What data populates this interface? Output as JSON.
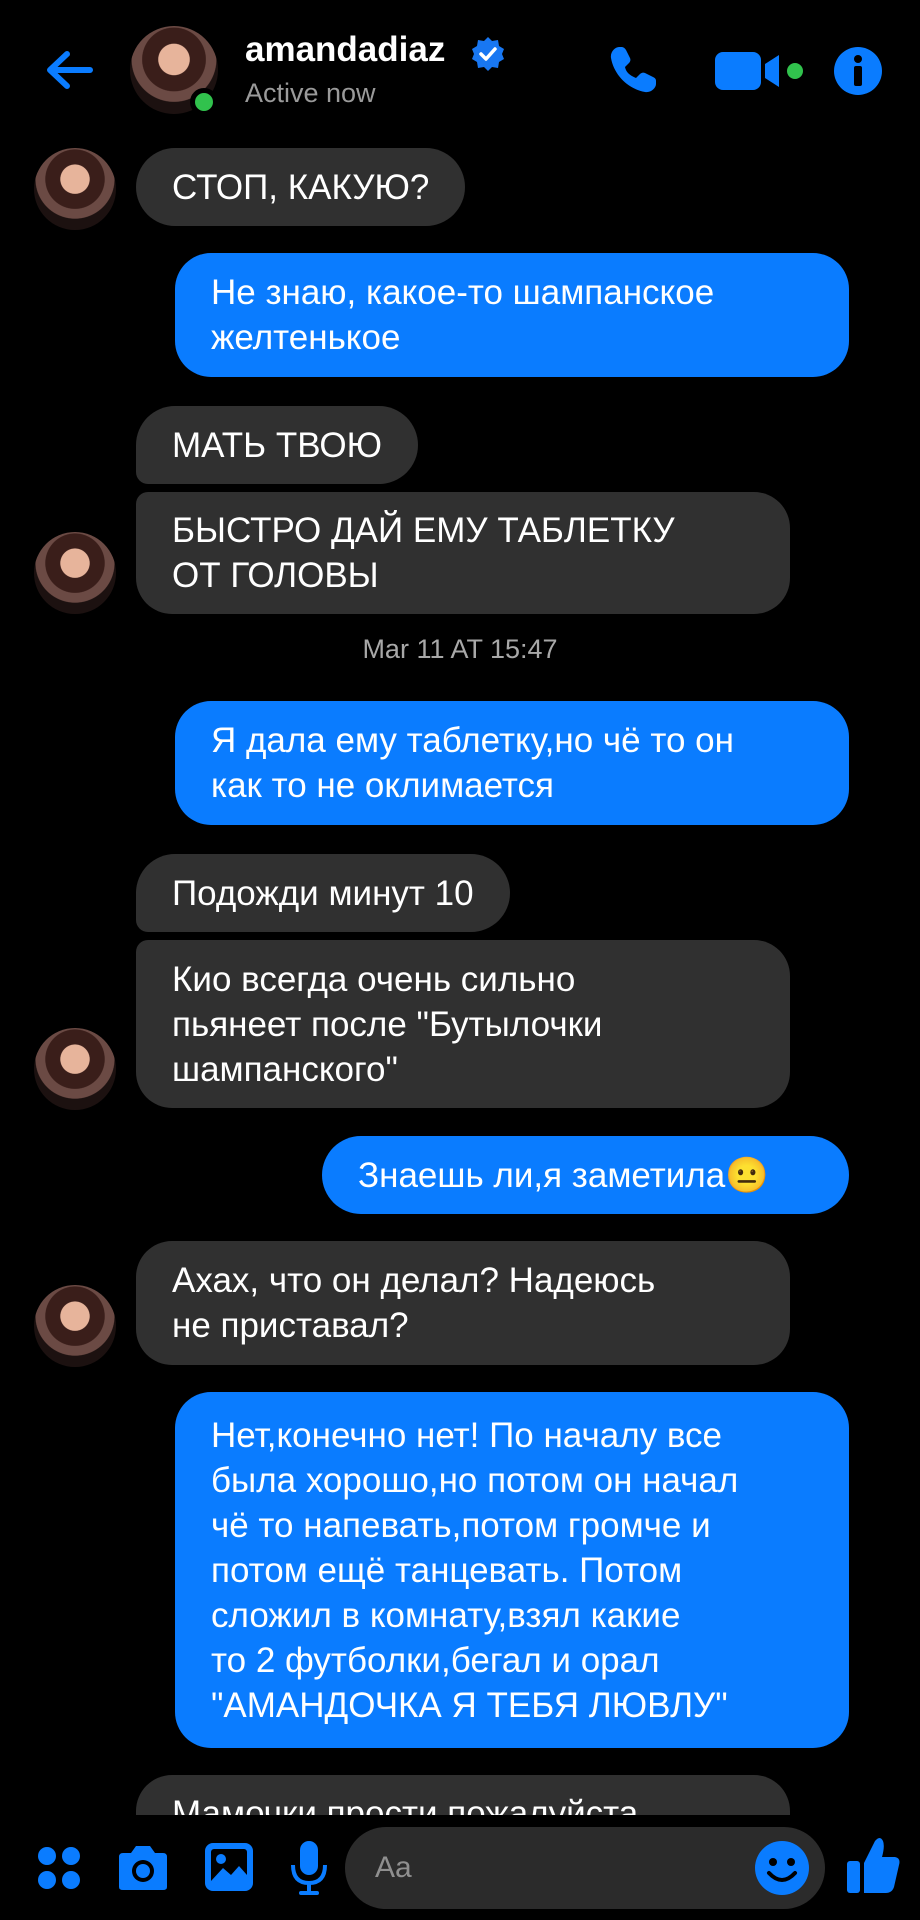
{
  "header": {
    "name": "amandadiaz",
    "status": "Active now"
  },
  "messages": [
    {
      "side": "in",
      "text": "СТОП, КАКУЮ?"
    },
    {
      "side": "out",
      "text": "Не знаю, какое-то шампанское\nжелтенькое"
    },
    {
      "side": "in",
      "text": "МАТЬ ТВОЮ"
    },
    {
      "side": "in",
      "text": "БЫСТРО ДАЙ ЕМУ ТАБЛЕТКУ\nОТ ГОЛОВЫ"
    },
    {
      "side": "timestamp",
      "text": "Mar 11 AT 15:47"
    },
    {
      "side": "out",
      "text": "Я дала ему таблетку,но чё то он\nкак то не оклимается"
    },
    {
      "side": "in",
      "text": "Подожди минут 10"
    },
    {
      "side": "in",
      "text": "Кио всегда очень сильно\nпьянеет после \"Бутылочки\nшампанского\""
    },
    {
      "side": "out",
      "text": "Знаешь ли,я заметила😐"
    },
    {
      "side": "in",
      "text": "Ахах, что он делал? Надеюсь\nне приставал?"
    },
    {
      "side": "out",
      "text": "Нет,конечно нет! По началу все\nбыла хорошо,но потом он начал\nчё то напевать,потом громче и\nпотом ещё танцевать. Потом\nсложил в комнату,взял какие\nто 2 футболки,бегал и орал\n\"АМАНДОЧКА Я ТЕБЯ ЛЮВЛУ\""
    },
    {
      "side": "in",
      "text": "Мамочки прости пожалуйста"
    }
  ],
  "composer": {
    "placeholder": "Aa"
  },
  "colors": {
    "accent": "#0a7cff",
    "incoming_bubble": "#303030",
    "online": "#31c24d"
  },
  "icons": {
    "back": "arrow-left-icon",
    "call": "phone-icon",
    "video": "video-camera-icon",
    "info": "info-icon",
    "menu": "four-dots-icon",
    "camera": "camera-icon",
    "gallery": "image-icon",
    "mic": "microphone-icon",
    "emoji": "smiley-icon",
    "like": "thumbs-up-icon"
  }
}
